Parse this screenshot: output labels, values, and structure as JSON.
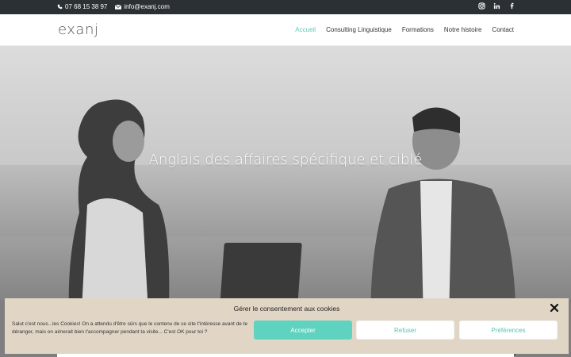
{
  "topbar": {
    "phone": "07 68 15 38 97",
    "email": "info@exanj.com",
    "social": [
      "instagram-icon",
      "linkedin-icon",
      "facebook-icon"
    ]
  },
  "header": {
    "logo": "exanj",
    "nav": [
      {
        "label": "Accueil",
        "active": true
      },
      {
        "label": "Consulting Linguistique",
        "active": false
      },
      {
        "label": "Formations",
        "active": false
      },
      {
        "label": "Notre histoire",
        "active": false
      },
      {
        "label": "Contact",
        "active": false
      }
    ]
  },
  "hero": {
    "title": "Anglais des affaires spécifique et ciblé"
  },
  "cookie": {
    "title": "Gérer le consentement aux cookies",
    "text": "Salut c'est nous...les Cookies! On a attendu d'être sûrs que le contenu de ce site t'intéresse avant de te déranger, mais on aimerait bien t'accompagner pendant ta visite... C'est OK pour toi ?",
    "accept": "Accepter",
    "refuse": "Refuser",
    "preferences": "Préférences"
  },
  "colors": {
    "accent": "#5dc9b7",
    "topbar": "#2b3035",
    "cookie_bg": "#e1d6c6"
  }
}
